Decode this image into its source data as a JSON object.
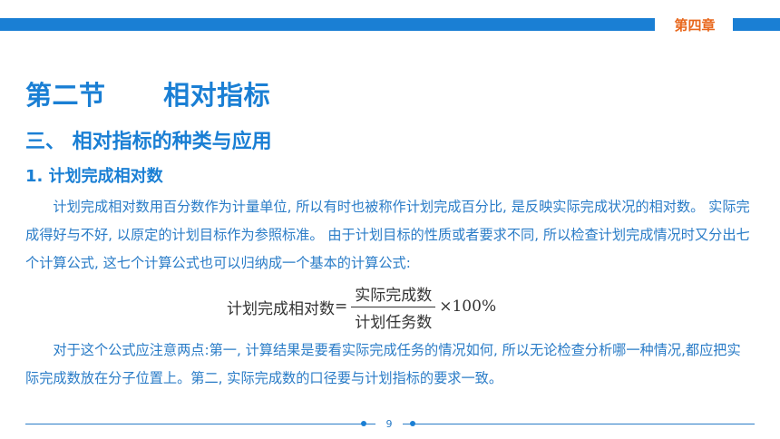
{
  "header": {
    "chapter": "第四章",
    "accent_color": "#1a7fd4",
    "chapter_color": "#e8671c"
  },
  "content": {
    "section_title": "第二节      相对指标",
    "subtitle": "三、 相对指标的种类与应用",
    "sub_subtitle": "1. 计划完成相对数",
    "paragraph1": "计划完成相对数用百分数作为计量单位, 所以有时也被称作计划完成百分比, 是反映实际完成状况的相对数。 实际完成得好与不好, 以原定的计划目标作为参照标准。 由于计划目标的性质或者要求不同, 所以检查计划完成情况时又分出七个计算公式, 这七个计算公式也可以归纳成一个基本的计算公式:",
    "formula": {
      "lhs": "计划完成相对数",
      "equals": "=",
      "numerator": "实际完成数",
      "denominator": "计划任务数",
      "multiplier": "×100%"
    },
    "paragraph2": "对于这个公式应注意两点:第一, 计算结果是要看实际完成任务的情况如何, 所以无论检查分析哪一种情况,都应把实际完成数放在分子位置上。第二, 实际完成数的口径要与计划指标的要求一致。"
  },
  "footer": {
    "page_number": "9"
  }
}
